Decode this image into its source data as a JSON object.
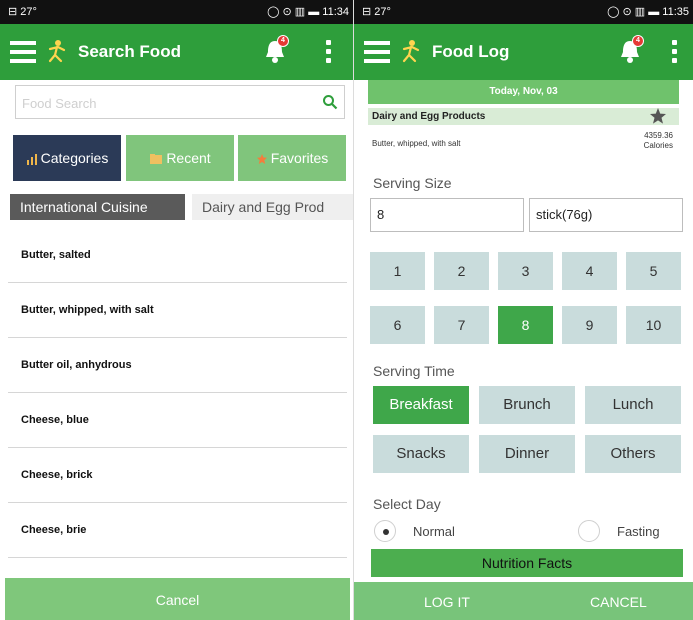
{
  "left": {
    "status": {
      "left": "⊟ 27°",
      "right": "◯ ⊙ ▥ ▬ 11:34"
    },
    "appbar": {
      "title": "Search Food",
      "badge": "4"
    },
    "search": {
      "placeholder": "Food Search"
    },
    "categories": [
      {
        "label": "Categories",
        "selected": true
      },
      {
        "label": "Recent",
        "selected": false
      },
      {
        "label": "Favorites",
        "selected": false
      }
    ],
    "subtabs": [
      {
        "label": "International Cuisine",
        "selected": true
      },
      {
        "label": "Dairy and Egg Prod",
        "selected": false
      }
    ],
    "foods": [
      "Butter, salted",
      "Butter, whipped, with salt",
      "Butter oil, anhydrous",
      "Cheese, blue",
      "Cheese, brick",
      "Cheese, brie"
    ],
    "cancel": "Cancel"
  },
  "right": {
    "status": {
      "left": "⊟ 27°",
      "right": "◯ ⊙ ▥ ▬ 11:35"
    },
    "appbar": {
      "title": "Food Log",
      "badge": "4"
    },
    "date": "Today, Nov, 03",
    "item": {
      "category": "Dairy and Egg Products",
      "name": "Butter, whipped, with salt",
      "calories": "4359.36",
      "calories_unit": "Calories"
    },
    "serving_size": {
      "label": "Serving Size",
      "qty": "8",
      "unit": "stick(76g)"
    },
    "numbers": [
      "1",
      "2",
      "3",
      "4",
      "5",
      "6",
      "7",
      "8",
      "9",
      "10"
    ],
    "selected_number": "8",
    "serving_time": {
      "label": "Serving Time",
      "options": [
        "Breakfast",
        "Brunch",
        "Lunch",
        "Snacks",
        "Dinner",
        "Others"
      ],
      "selected": "Breakfast"
    },
    "select_day": {
      "label": "Select Day",
      "normal": "Normal",
      "fasting": "Fasting",
      "selected": "Normal"
    },
    "nutrition": "Nutrition Facts",
    "log_it": "LOG IT",
    "cancel": "CANCEL"
  },
  "colors": {
    "appbar": "#2e9e3b",
    "accent_light": "#80c57c",
    "category_selected": "#2b3a57",
    "grid_button": "#c9dcdc",
    "grid_selected": "#3fa74a"
  },
  "icons": [
    "menu-icon",
    "logo-icon",
    "bell-icon",
    "more-vert-icon",
    "search-icon",
    "categories-icon",
    "recent-icon",
    "favorites-icon",
    "star-icon"
  ]
}
